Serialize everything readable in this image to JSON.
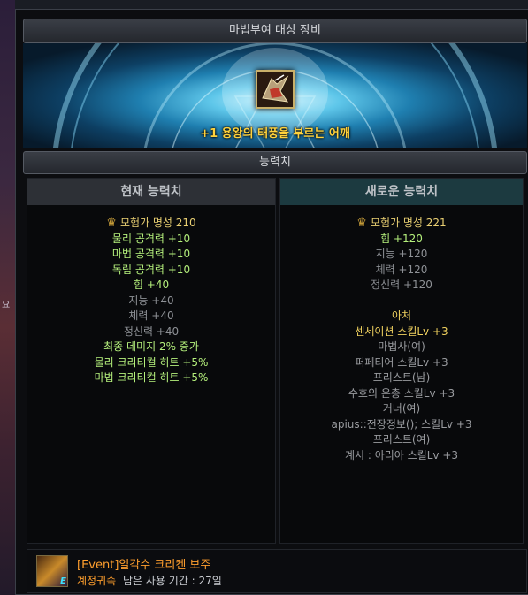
{
  "window": {
    "title": "마법부여 대상 장비",
    "item_label": "+1  용왕의 태풍을 부르는 어깨",
    "section_title": "능력치"
  },
  "current": {
    "header": "현재 능력치",
    "fame": "모험가 명성 210",
    "stats": [
      {
        "text": "물리 공격력 +10",
        "style": "green"
      },
      {
        "text": "마법 공격력 +10",
        "style": "green"
      },
      {
        "text": "독립 공격력 +10",
        "style": "green"
      },
      {
        "text": "힘 +40",
        "style": "green"
      },
      {
        "text": "지능 +40",
        "style": "gray"
      },
      {
        "text": "체력 +40",
        "style": "gray"
      },
      {
        "text": "정신력 +40",
        "style": "gray"
      },
      {
        "text": "최종 데미지 2% 증가",
        "style": "green"
      },
      {
        "text": "물리 크리티컬 히트 +5%",
        "style": "green"
      },
      {
        "text": "마법 크리티컬 히트 +5%",
        "style": "green"
      }
    ]
  },
  "new": {
    "header": "새로운 능력치",
    "fame": "모험가 명성 221",
    "stats": [
      {
        "text": "힘 +120",
        "style": "green"
      },
      {
        "text": "지능 +120",
        "style": "gray"
      },
      {
        "text": "체력 +120",
        "style": "gray"
      },
      {
        "text": "정신력 +120",
        "style": "gray"
      }
    ],
    "set_name": "아처",
    "skills": [
      {
        "text": "센세이션 스킬Lv +3",
        "style": "gold"
      },
      {
        "text": "마법사(여)",
        "style": "desc"
      },
      {
        "text": "퍼페티어 스킬Lv +3",
        "style": "desc"
      },
      {
        "text": "프리스트(남)",
        "style": "desc"
      },
      {
        "text": "수호의 은총 스킬Lv +3",
        "style": "desc"
      },
      {
        "text": "거너(여)",
        "style": "desc"
      },
      {
        "text": "apius::전장정보(); 스킬Lv +3",
        "style": "desc"
      },
      {
        "text": "프리스트(여)",
        "style": "desc"
      },
      {
        "text": "계시 : 아리아 스킬Lv +3",
        "style": "desc"
      }
    ]
  },
  "footer": {
    "item_name": "[Event]일각수 크리켄 보주",
    "bind_type": "계정귀속",
    "remaining": "남은 사용 기간 : 27일",
    "badge": "E"
  },
  "background": {
    "side_text": "요"
  },
  "icons": {
    "fame": "crown-icon",
    "equipment": "shoulder-armor-icon",
    "orb": "orb-icon"
  },
  "colors": {
    "green_stat": "#b5f07c",
    "gray_stat": "#8e9196",
    "gold": "#f1d25f",
    "orange": "#ff9f2e",
    "new_header_bg": "#1c3a40"
  }
}
